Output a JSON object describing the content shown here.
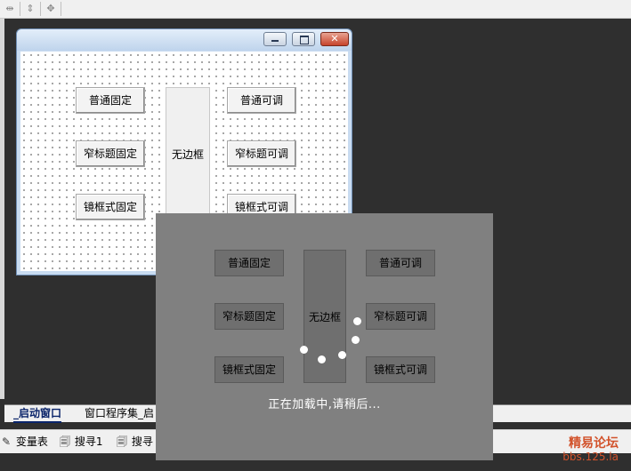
{
  "toolbar": {
    "icons": [
      "equal-width-icon",
      "equal-height-icon",
      "equal-size-icon"
    ]
  },
  "designer_window": {
    "caption_buttons": [
      "minimize-icon",
      "maximize-icon",
      "close-icon"
    ],
    "buttons": {
      "normal_fixed": "普通固定",
      "normal_adjustable": "普通可调",
      "narrow_title_fixed": "窄标题固定",
      "narrow_title_adjustable": "窄标题可调",
      "mirror_frame_fixed": "镜框式固定",
      "mirror_frame_adjustable": "镜框式可调"
    },
    "borderless_panel": "无边框"
  },
  "overlay": {
    "buttons": {
      "normal_fixed": "普通固定",
      "normal_adjustable": "普通可调",
      "narrow_title_fixed": "窄标题固定",
      "narrow_title_adjustable": "窄标题可调",
      "mirror_frame_fixed": "镜框式固定",
      "mirror_frame_adjustable": "镜框式可调"
    },
    "borderless_panel": "无边框",
    "loading_text": "正在加载中,请稍后..."
  },
  "tabs": [
    {
      "label": "_启动窗口",
      "active": true
    },
    {
      "label": "窗口程序集_启"
    }
  ],
  "status_bar": {
    "items": [
      {
        "label": "变量表",
        "icon": "variables-icon"
      },
      {
        "label": "搜寻1",
        "icon": "search-icon"
      },
      {
        "label": "搜寻",
        "icon": "search-icon"
      }
    ]
  },
  "watermark": {
    "line1": "精易论坛",
    "line2": "bbs.125.la"
  },
  "colors": {
    "overlay_bg": "#808080",
    "logo": "#d2532c",
    "tab_active": "#0a246a"
  }
}
